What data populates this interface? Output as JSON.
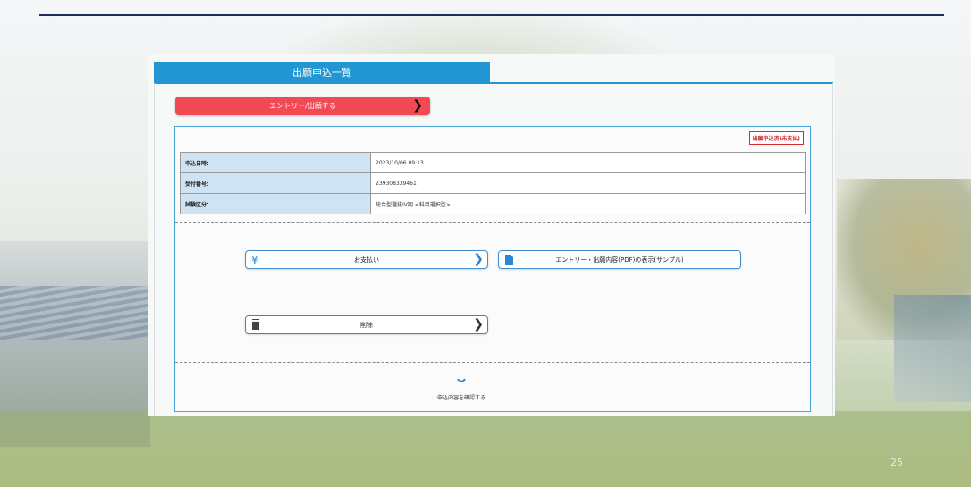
{
  "tab": {
    "label": "出願申込一覧"
  },
  "entry_button": {
    "label": "エントリー/出願する",
    "arrow": "❯"
  },
  "status_badge": "出願申込済(未支払)",
  "info_table": [
    {
      "label": "申込日時：",
      "value": "2023/10/06 09:13"
    },
    {
      "label": "受付番号：",
      "value": "239308339461"
    },
    {
      "label": "試験区分：",
      "value": "総合型選抜IV期 <科目選択型>"
    }
  ],
  "actions": {
    "payment": {
      "label": "お支払い",
      "icon": "yen-icon",
      "icon_glyph": "¥",
      "arrow": "❯"
    },
    "pdf": {
      "label": "エントリー・出願内容(PDF)の表示(サンプル)",
      "icon": "document-icon"
    },
    "delete": {
      "label": "削除",
      "icon": "trash-icon",
      "arrow": "❯"
    }
  },
  "confirm": {
    "label": "申込内容を確認する",
    "icon": "chevron-down-icon",
    "glyph": "⌄"
  },
  "slide_number": "25",
  "colors": {
    "accent": "#2196d3",
    "entry_button": "#f24a55",
    "status_red": "#d12b2b",
    "table_header": "#cfe3f3",
    "rule": "#1f2d5c"
  }
}
